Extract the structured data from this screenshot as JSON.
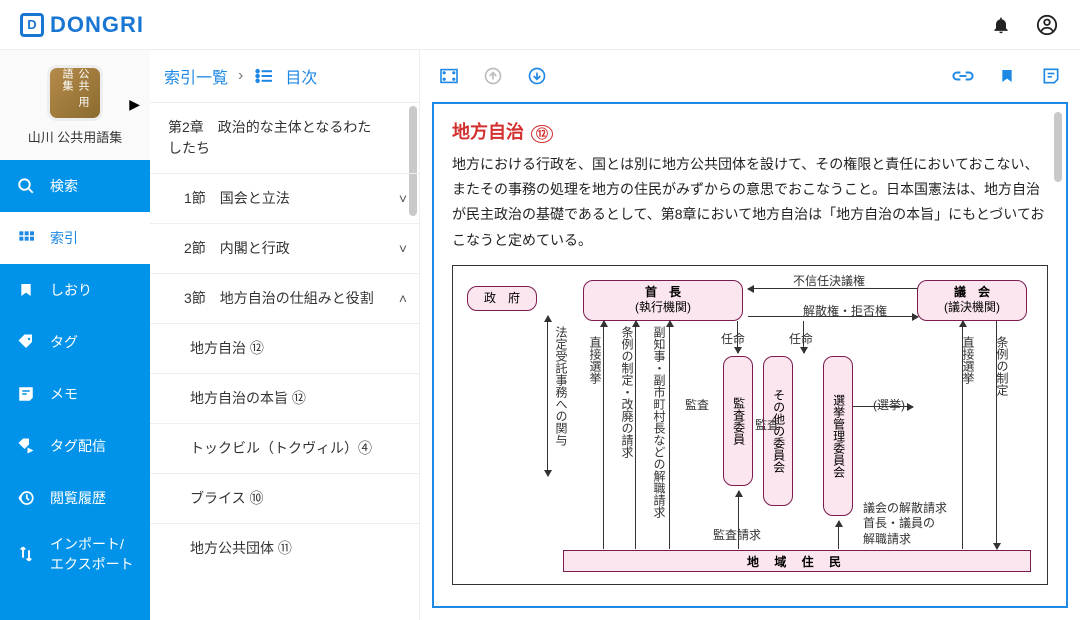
{
  "header": {
    "brand": "DONGRI"
  },
  "sidebar": {
    "dict_name": "山川 公共用語集",
    "dict_img_label": "公共\n用語集",
    "items": [
      {
        "icon": "search",
        "label": "検索"
      },
      {
        "icon": "grid",
        "label": "索引"
      },
      {
        "icon": "bookmark",
        "label": "しおり"
      },
      {
        "icon": "tag",
        "label": "タグ"
      },
      {
        "icon": "note",
        "label": "メモ"
      },
      {
        "icon": "tagdist",
        "label": "タグ配信"
      },
      {
        "icon": "history",
        "label": "閲覧履歴"
      },
      {
        "icon": "impexp",
        "label": "インポート/\nエクスポート"
      }
    ]
  },
  "index_panel": {
    "crumb1": "索引一覧",
    "crumb2": "目次",
    "items": [
      {
        "level": 1,
        "label": "第2章　政治的な主体となるわたしたち",
        "chev": ""
      },
      {
        "level": 2,
        "label": "1節　国会と立法",
        "chev": "˅"
      },
      {
        "level": 2,
        "label": "2節　内閣と行政",
        "chev": "˅"
      },
      {
        "level": 2,
        "label": "3節　地方自治の仕組みと役割",
        "chev": "˄"
      },
      {
        "level": 3,
        "label": "地方自治 ⑫"
      },
      {
        "level": 3,
        "label": "地方自治の本旨 ⑫"
      },
      {
        "level": 3,
        "label": "トックビル（トクヴィル）④"
      },
      {
        "level": 3,
        "label": "ブライス ⑩"
      },
      {
        "level": 3,
        "label": "地方公共団体 ⑪"
      }
    ]
  },
  "article": {
    "title": "地方自治",
    "title_badge": "⑫",
    "body": "地方における行政を、国とは別に地方公共団体を設けて、その権限と責任においておこない、またその事務の処理を地方の住民がみずからの意思でおこなうこと。日本国憲法は、地方自治が民主政治の基礎であるとして、第8章において地方自治は「地方自治の本旨」にもとづいておこなうと定めている。",
    "diagram": {
      "gov": "政　府",
      "chief": "首　長",
      "chief_sub": "(執行機関)",
      "council": "議　会",
      "council_sub": "(議決機関)",
      "audit": "監査委員",
      "other": "その他の委員会",
      "elect": "選挙管理委員会",
      "residents": "地 域 住 民",
      "lbl_noconfidence": "不信任決議権",
      "lbl_dissolve": "解散権・拒否権",
      "lbl_appoint": "任命",
      "lbl_audit": "監査",
      "lbl_election": "(選挙)",
      "lbl_direct_elect": "直接選挙",
      "lbl_ord_enact": "条例の制定",
      "lbl_delegated": "法定受託事務への関与",
      "lbl_ord_amend": "条例の制定・改廃の請求",
      "lbl_vice_recall": "副知事・副市町村長などの解職請求",
      "lbl_audit_req": "監査請求",
      "lbl_council_recall": "議会の解散請求\n首長・議員の\n解職請求"
    }
  }
}
